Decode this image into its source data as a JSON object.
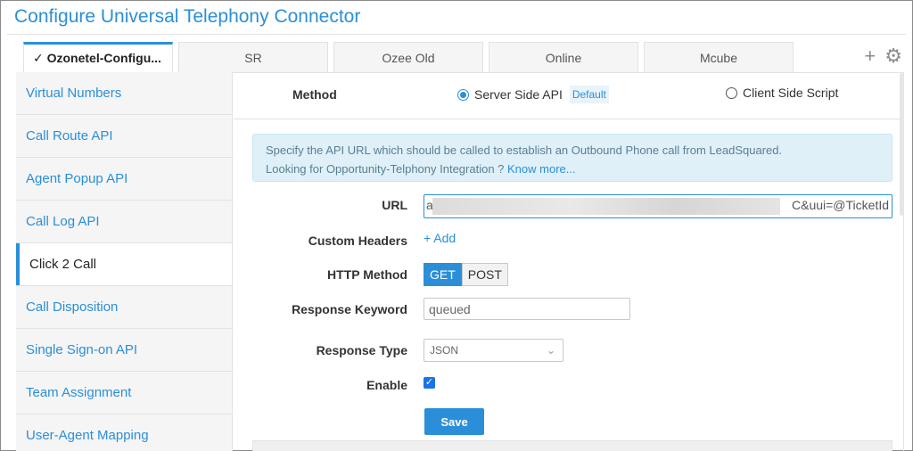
{
  "page": {
    "title": "Configure Universal Telephony Connector"
  },
  "tabs": [
    {
      "label": "✓ Ozonetel-Configu..."
    },
    {
      "label": "SR"
    },
    {
      "label": "Ozee Old"
    },
    {
      "label": "Online"
    },
    {
      "label": "Mcube"
    }
  ],
  "tab_actions": {
    "add_icon": "+",
    "settings_icon": "⚙"
  },
  "sidebar": {
    "items": [
      {
        "label": "Virtual Numbers"
      },
      {
        "label": "Call Route API"
      },
      {
        "label": "Agent Popup API"
      },
      {
        "label": "Call Log API"
      },
      {
        "label": "Click 2 Call"
      },
      {
        "label": "Call Disposition"
      },
      {
        "label": "Single Sign-on API"
      },
      {
        "label": "Team Assignment"
      },
      {
        "label": "User-Agent Mapping"
      }
    ],
    "active": "Click 2 Call"
  },
  "method": {
    "label": "Method",
    "option_server": "Server Side API",
    "default_badge": "Default",
    "option_client": "Client Side Script",
    "selected": "Server Side API"
  },
  "info": {
    "line1": "Specify the API URL which should be called to establish an Outbound Phone call from LeadSquared.",
    "line2": "Looking for Opportunity-Telphony Integration ?",
    "link": "Know more..."
  },
  "form": {
    "url_label": "URL",
    "url_lead": "a",
    "url_tail": "C&uui=@TicketId",
    "custom_headers_label": "Custom Headers",
    "add_link": "+ Add",
    "http_method_label": "HTTP Method",
    "http_get": "GET",
    "http_post": "POST",
    "http_selected": "GET",
    "response_keyword_label": "Response Keyword",
    "response_keyword_value": "queued",
    "response_type_label": "Response Type",
    "response_type_value": "JSON",
    "enable_label": "Enable",
    "enable_checked": true,
    "save_label": "Save"
  },
  "colors": {
    "accent": "#2a8fd8",
    "info_bg": "#dff0f9",
    "sidebar_bg": "#f5f5f5"
  }
}
